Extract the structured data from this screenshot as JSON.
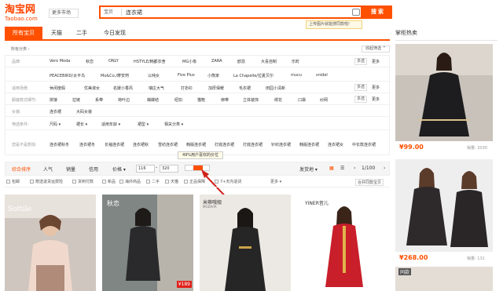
{
  "logo": {
    "text": "淘宝网",
    "sub": "Taobao.com"
  },
  "header": {
    "more_market": "更多市场",
    "search_type": "宝贝",
    "search_value": "连衣裙",
    "search_button": "搜 索",
    "upload_tip": "上传图片就能搜同款啦!"
  },
  "tabs": [
    {
      "label": "所有宝贝"
    },
    {
      "label": "天猫"
    },
    {
      "label": "二手"
    },
    {
      "label": "今日发现"
    }
  ],
  "sidebar": {
    "title": "掌柜热卖",
    "items": [
      {
        "price": "¥99.00",
        "sales": "销量: 3030"
      },
      {
        "price": "¥268.00",
        "sales": "销量: 131"
      },
      {
        "badge": "同款"
      }
    ]
  },
  "breadcrumb": "所有分类 ›",
  "collapse_button": "收起筛选 ^",
  "filters": [
    {
      "label": "品牌:",
      "items": [
        "Vero Moda",
        "秋恋",
        "ONLY",
        "HSTYLE/韩都衣舍",
        "MG小象",
        "ZARA",
        "欧恩",
        "大喜自制",
        "乐町"
      ],
      "btn_multi": "多选",
      "btn_more": "更多"
    },
    {
      "label": "",
      "items": [
        "PEACEBIRD/太平鸟",
        "Mo&Co./摩安珂",
        "以纯女",
        "Five Plus",
        "小熊家",
        "La Chapelle/拉夏贝尔",
        "mucu",
        "snidel"
      ]
    },
    {
      "label": "适用场景:",
      "items": [
        "休闲度假",
        "优美淑女",
        "名媛小香风",
        "瑞庄大气",
        "打扮衫",
        "加厚保暖",
        "毛衣裙",
        "田园小清新"
      ],
      "btn_multi": "多选",
      "btn_more": "更多"
    },
    {
      "label": "服装款式细节:",
      "items": [
        "拼接",
        "拉链",
        "系带",
        "荷叶边",
        "蝴蝶结",
        "纽扣",
        "猫鞋",
        "绑带",
        "立体装饰",
        "绣花",
        "口袋",
        "纱网"
      ],
      "btn_multi": "多选",
      "btn_more": "更多"
    },
    {
      "label": "女装:",
      "items": [
        "连衣裙",
        "大码女装"
      ]
    },
    {
      "label": "筛选条件:",
      "items": [
        "尺码 ▾",
        "裙长 ▾",
        "适用年龄 ▾",
        "裙型 ▾",
        "相关分类 ▾"
      ]
    },
    {
      "label": "您是不是想找:",
      "items": [
        "连衣裙秋冬",
        "连衣裙冬",
        "长袖连衣裙",
        "连衣裙秋",
        "雪纺连衣裙",
        "韩版连衣裙",
        "打底连衣裙",
        "打底连衣裙",
        "针织连衣裙",
        "韩版连衣裙",
        "连衣裙女",
        "中长款连衣裙"
      ]
    }
  ],
  "sortbar": {
    "items": [
      "综合排序",
      "人气",
      "销量",
      "信用",
      "价格 ▾"
    ],
    "price_min": "116",
    "price_max": "320",
    "ship_from": "发货地 ▾",
    "page": "1/100",
    "tooltip": "49%用户喜欢的价位"
  },
  "options": {
    "items": [
      "包邮",
      "赠送退货运费险",
      "货到付款",
      "新品",
      "海外商品",
      "二手",
      "天猫",
      "正品保障",
      "7+天内退货"
    ],
    "more": "更多 ▾",
    "same_store": "合并同款宝贝"
  },
  "products": [
    {
      "brand": "Sottile"
    },
    {
      "brand": "秋恋",
      "price_tag": "¥189"
    },
    {
      "brand": "米蒂哦舰",
      "sub": "MODIVIA"
    },
    {
      "brand": "YINER音儿"
    }
  ],
  "colors": {
    "accent": "#ff5000",
    "tab_active": "#ff5000"
  }
}
